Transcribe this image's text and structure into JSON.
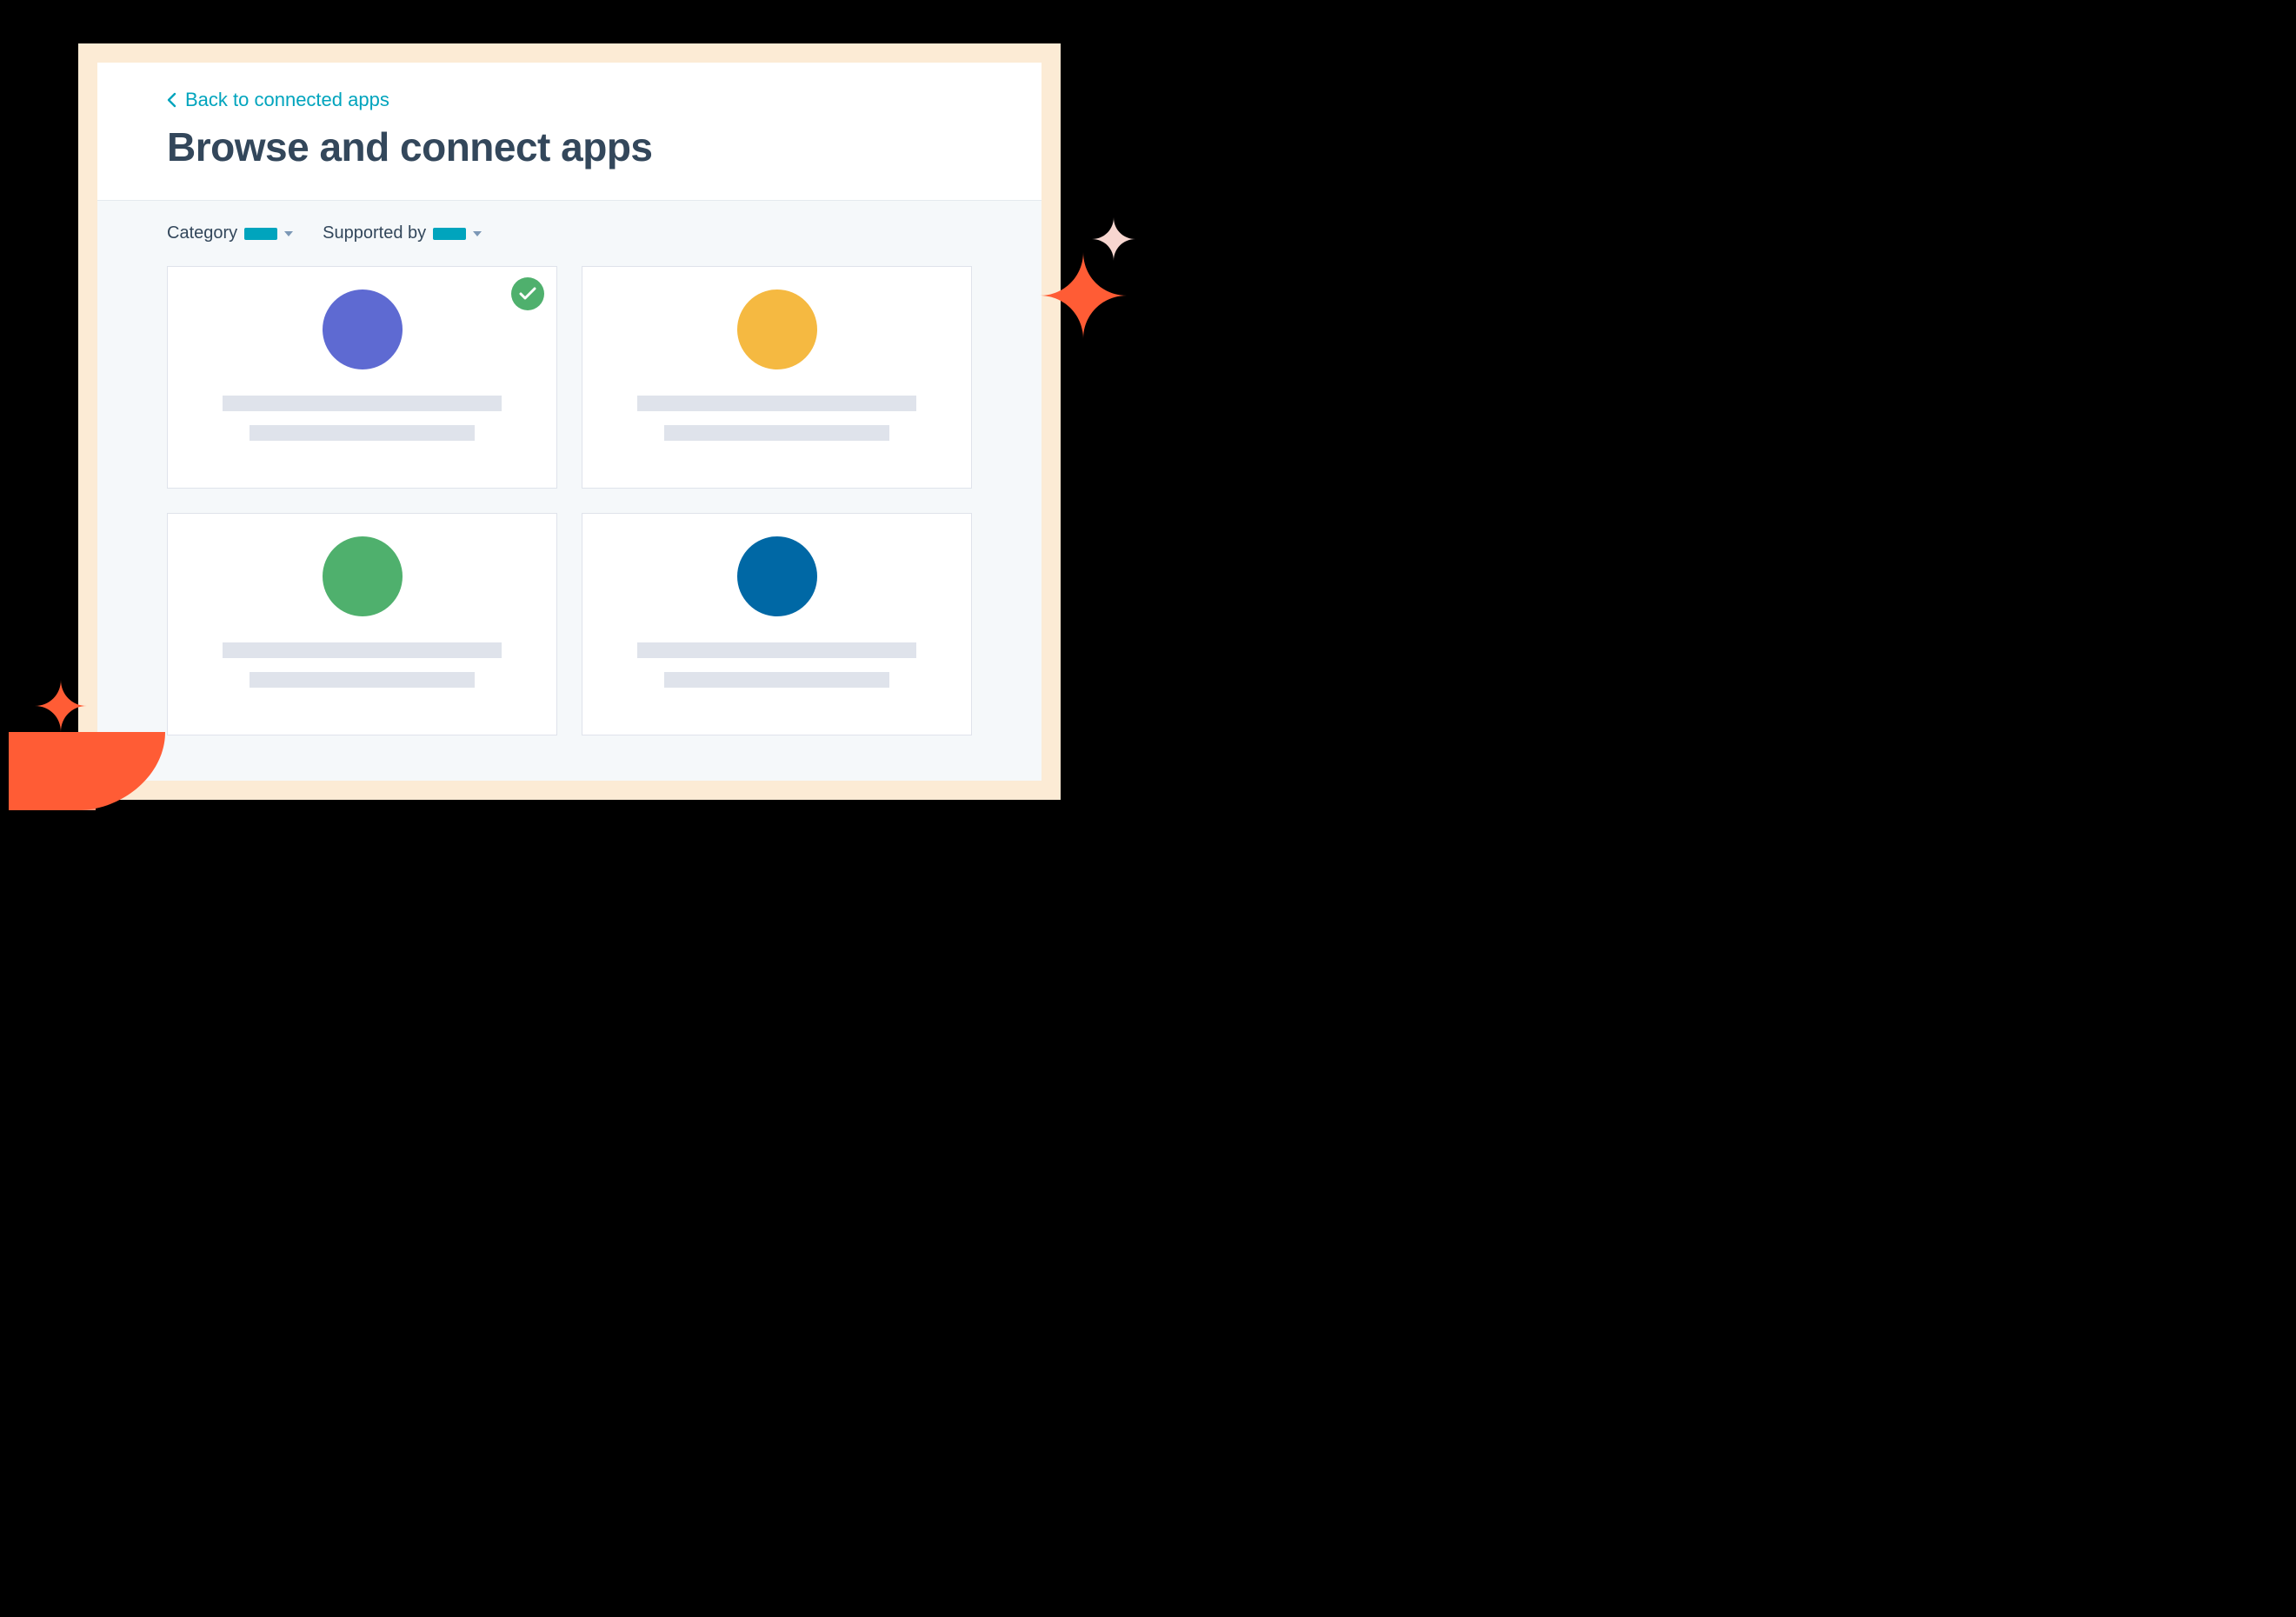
{
  "header": {
    "back_label": "Back to connected apps",
    "title": "Browse and connect apps"
  },
  "filters": {
    "category_label": "Category",
    "supported_label": "Supported by"
  },
  "colors": {
    "accent": "#00A4BD",
    "card_circles": [
      "#5E6AD2",
      "#F5B941",
      "#4FB06D",
      "#0068A5"
    ]
  },
  "apps": [
    {
      "connected": true
    },
    {
      "connected": false
    },
    {
      "connected": false
    },
    {
      "connected": false
    }
  ]
}
